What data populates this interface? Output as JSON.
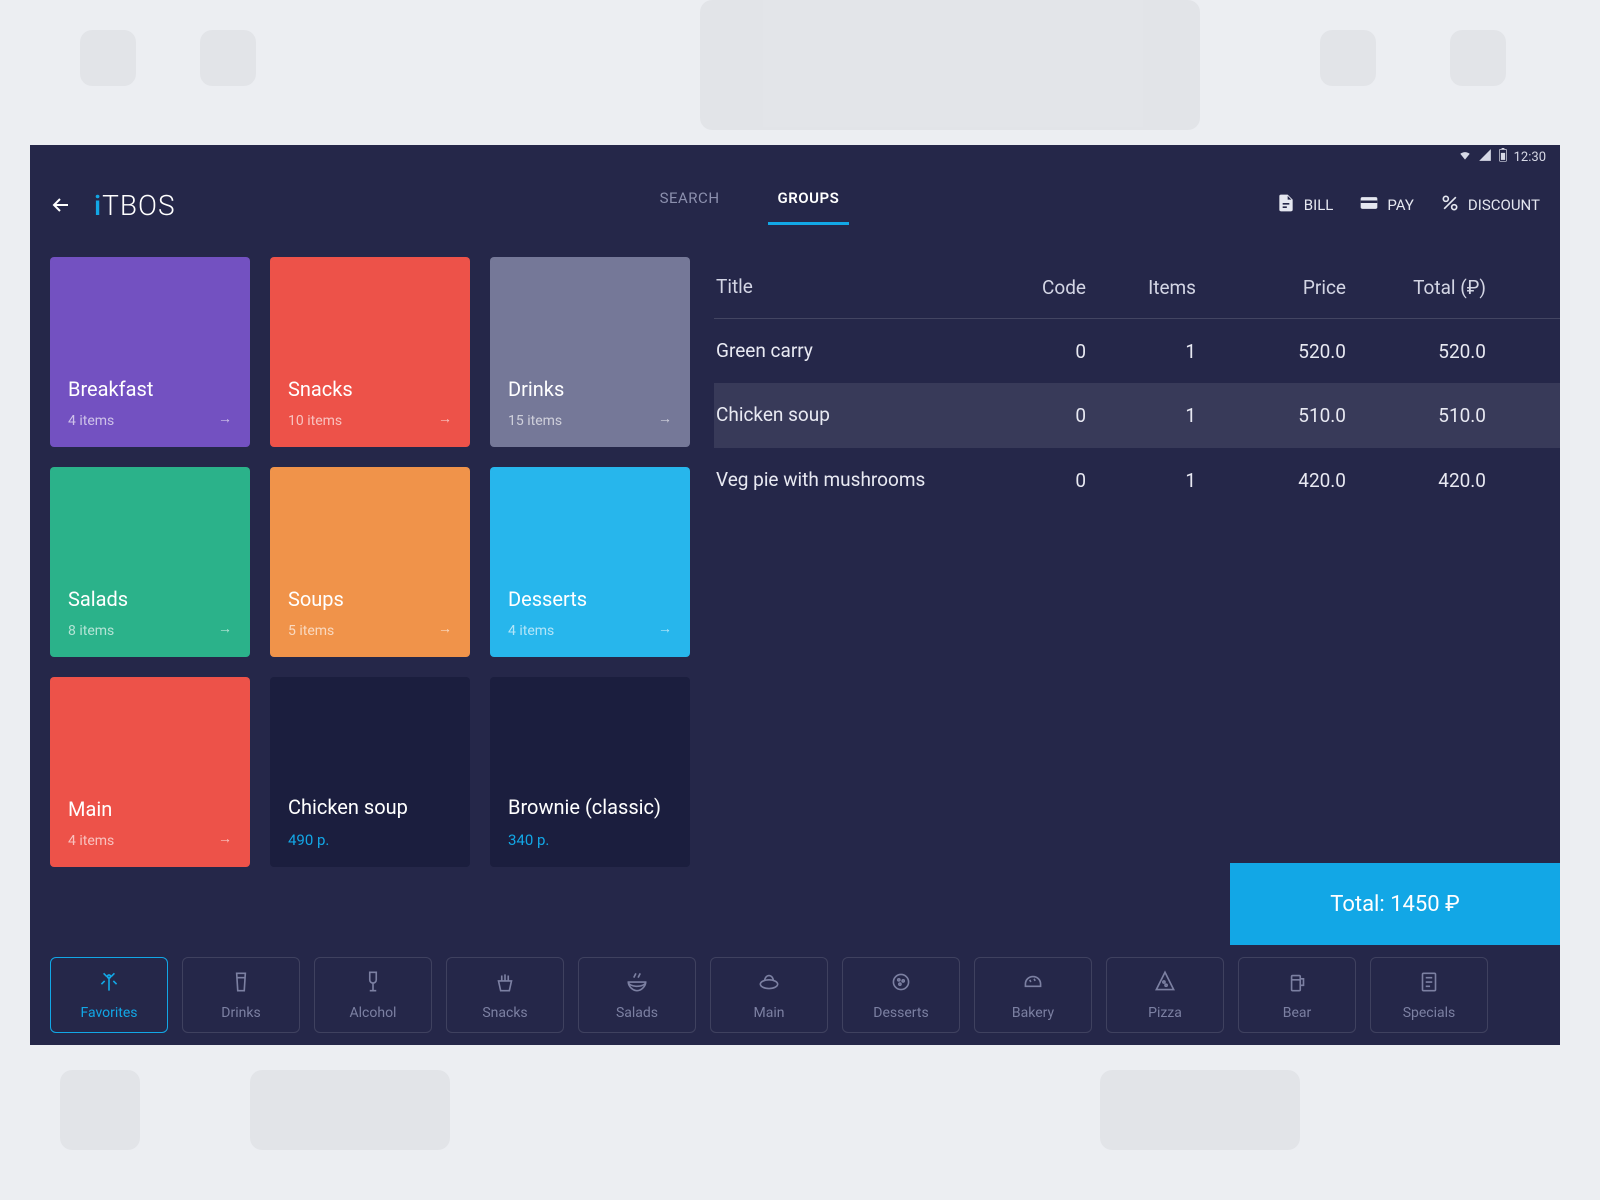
{
  "statusBar": {
    "time": "12:30"
  },
  "brand": {
    "prefix": "i",
    "main": "TBOS"
  },
  "tabs": {
    "search": "SEARCH",
    "groups": "GROUPS",
    "active": "groups"
  },
  "headerActions": {
    "bill": "BILL",
    "pay": "PAY",
    "discount": "DISCOUNT"
  },
  "tiles": [
    {
      "title": "Breakfast",
      "sub": "4 items",
      "color": "#7351c1",
      "arrow": true
    },
    {
      "title": "Snacks",
      "sub": "10 items",
      "color": "#ed5249",
      "arrow": true
    },
    {
      "title": "Drinks",
      "sub": "15 items",
      "color": "#757898",
      "arrow": true
    },
    {
      "title": "Salads",
      "sub": "8 items",
      "color": "#2bb28a",
      "arrow": true
    },
    {
      "title": "Soups",
      "sub": "5 items",
      "color": "#f0934a",
      "arrow": true
    },
    {
      "title": "Desserts",
      "sub": "4 items",
      "color": "#27b6ec",
      "arrow": true
    },
    {
      "title": "Main",
      "sub": "4 items",
      "color": "#ed5249",
      "arrow": true
    },
    {
      "title": "Chicken soup",
      "price": "490 p.",
      "color": "#1b1e3e",
      "arrow": false
    },
    {
      "title": "Brownie (classic)",
      "price": "340 p.",
      "color": "#1b1e3e",
      "arrow": false
    }
  ],
  "order": {
    "headers": {
      "title": "Title",
      "code": "Code",
      "items": "Items",
      "price": "Price",
      "total": "Total (₽)"
    },
    "rows": [
      {
        "title": "Green carry",
        "code": "0",
        "items": "1",
        "price": "520.0",
        "total": "520.0",
        "selected": false
      },
      {
        "title": "Chicken soup",
        "code": "0",
        "items": "1",
        "price": "510.0",
        "total": "510.0",
        "selected": true
      },
      {
        "title": "Veg pie with mushrooms",
        "code": "0",
        "items": "1",
        "price": "420.0",
        "total": "420.0",
        "selected": false
      }
    ],
    "totalLabel": "Total: 1450 ₽"
  },
  "categories": [
    {
      "label": "Favorites",
      "icon": "favorites",
      "active": true
    },
    {
      "label": "Drinks",
      "icon": "drinks",
      "active": false
    },
    {
      "label": "Alcohol",
      "icon": "alcohol",
      "active": false
    },
    {
      "label": "Snacks",
      "icon": "snacks",
      "active": false
    },
    {
      "label": "Salads",
      "icon": "salads",
      "active": false
    },
    {
      "label": "Main",
      "icon": "main",
      "active": false
    },
    {
      "label": "Desserts",
      "icon": "desserts",
      "active": false
    },
    {
      "label": "Bakery",
      "icon": "bakery",
      "active": false
    },
    {
      "label": "Pizza",
      "icon": "pizza",
      "active": false
    },
    {
      "label": "Bear",
      "icon": "bear",
      "active": false
    },
    {
      "label": "Specials",
      "icon": "specials",
      "active": false
    }
  ]
}
